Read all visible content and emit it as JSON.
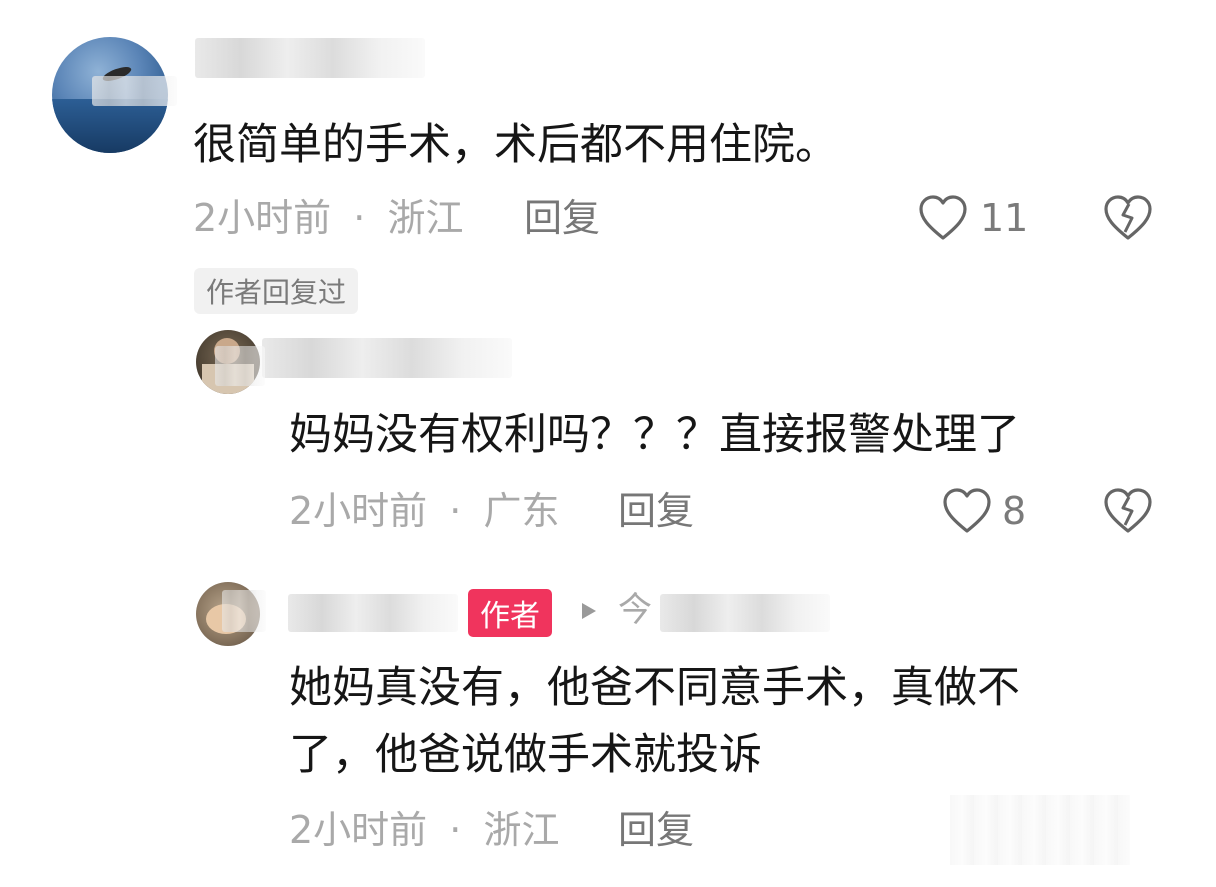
{
  "comments": [
    {
      "text": "很简单的手术，术后都不用住院。",
      "time": "2小时前",
      "separator": "·",
      "location": "浙江",
      "reply_label": "回复",
      "likes": "11",
      "author_replied_tag": "作者回复过"
    },
    {
      "text": "妈妈没有权利吗？？？直接报警处理了",
      "time": "2小时前",
      "separator": "·",
      "location": "广东",
      "reply_label": "回复",
      "likes": "8"
    },
    {
      "author_badge": "作者",
      "reply_to_fragment": "今",
      "text_line1": "她妈真没有，他爸不同意手术，真做不",
      "text_line2": "了，他爸说做手术就投诉",
      "time": "2小时前",
      "separator": "·",
      "location": "浙江",
      "reply_label": "回复"
    }
  ],
  "colors": {
    "author_badge": "#f0345d",
    "meta_text": "#a9a9a9",
    "body_text": "#161616"
  },
  "icons": [
    "heart-outline-icon",
    "broken-heart-icon",
    "play-arrow-icon"
  ]
}
